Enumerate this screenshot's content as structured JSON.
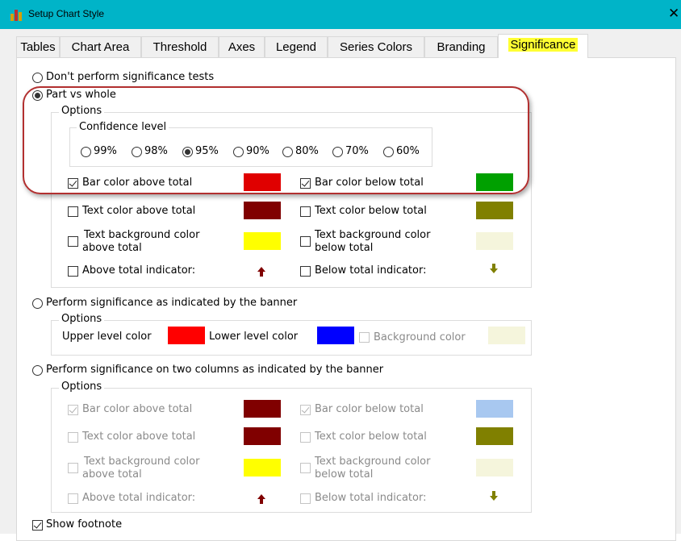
{
  "window": {
    "title": "Setup Chart Style",
    "close_glyph": "✕"
  },
  "tabs": [
    {
      "label": "Tables",
      "active": false
    },
    {
      "label": "Chart Area",
      "active": false
    },
    {
      "label": "Threshold",
      "active": false
    },
    {
      "label": "Axes",
      "active": false
    },
    {
      "label": "Legend",
      "active": false
    },
    {
      "label": "Series Colors",
      "active": false
    },
    {
      "label": "Branding",
      "active": false
    },
    {
      "label": "Significance",
      "active": true
    }
  ],
  "significance": {
    "no_tests": {
      "label": "Don't perform significance tests",
      "selected": false
    },
    "part_vs_whole": {
      "label": "Part vs whole",
      "selected": true,
      "options_label": "Options",
      "confidence_label": "Confidence level",
      "confidence_levels": [
        {
          "label": "99%",
          "selected": false
        },
        {
          "label": "98%",
          "selected": false
        },
        {
          "label": "95%",
          "selected": true
        },
        {
          "label": "90%",
          "selected": false
        },
        {
          "label": "80%",
          "selected": false
        },
        {
          "label": "70%",
          "selected": false
        },
        {
          "label": "60%",
          "selected": false
        }
      ],
      "bar_above": {
        "label": "Bar color above total",
        "checked": true,
        "color": "#e00000"
      },
      "bar_below": {
        "label": "Bar color below total",
        "checked": true,
        "color": "#00a000"
      },
      "text_above": {
        "label": "Text color above total",
        "checked": false,
        "color": "#800000"
      },
      "text_below": {
        "label": "Text color below total",
        "checked": false,
        "color": "#808000"
      },
      "textbg_above": {
        "label_line1": "Text background color",
        "label_line2": "above total",
        "checked": false,
        "color": "#ffff00"
      },
      "textbg_below": {
        "label_line1": "Text background color",
        "label_line2": "below total",
        "checked": false,
        "color": "#f5f5dc"
      },
      "above_indicator": {
        "label": "Above total indicator:",
        "checked": false,
        "icon": "up-arrow-icon",
        "color": "#800000"
      },
      "below_indicator": {
        "label": "Below total indicator:",
        "checked": false,
        "icon": "down-arrow-icon",
        "color": "#808000"
      }
    },
    "banner": {
      "label": "Perform significance as indicated by the banner",
      "selected": false,
      "options_label": "Options",
      "upper_label": "Upper level color",
      "upper_color": "#ff0000",
      "lower_label": "Lower level color",
      "lower_color": "#0000ff",
      "background_label": "Background color",
      "background_checked": false,
      "background_color": "#f5f5dc"
    },
    "two_columns": {
      "label": "Perform significance on two columns as indicated by the banner",
      "selected": false,
      "options_label": "Options",
      "bar_above": {
        "label": "Bar color above total",
        "checked": true,
        "color": "#800000"
      },
      "bar_below": {
        "label": "Bar color below total",
        "checked": true,
        "color": "#a8c8f0"
      },
      "text_above": {
        "label": "Text color above total",
        "checked": false,
        "color": "#800000"
      },
      "text_below": {
        "label": "Text color below total",
        "checked": false,
        "color": "#808000"
      },
      "textbg_above": {
        "label_line1": "Text background color",
        "label_line2": "above total",
        "checked": false,
        "color": "#ffff00"
      },
      "textbg_below": {
        "label_line1": "Text background color",
        "label_line2": "below total",
        "checked": false,
        "color": "#f5f5dc"
      },
      "above_indicator": {
        "label": "Above total indicator:",
        "checked": false,
        "icon": "up-arrow-icon",
        "color": "#800000"
      },
      "below_indicator": {
        "label": "Below total indicator:",
        "checked": false,
        "icon": "down-arrow-icon",
        "color": "#808000"
      }
    },
    "show_footnote": {
      "label": "Show footnote",
      "checked": true
    }
  },
  "colors": {
    "titlebar": "#00b4c8",
    "annotation": "#b23030",
    "tab_highlight": "#ffff33"
  }
}
